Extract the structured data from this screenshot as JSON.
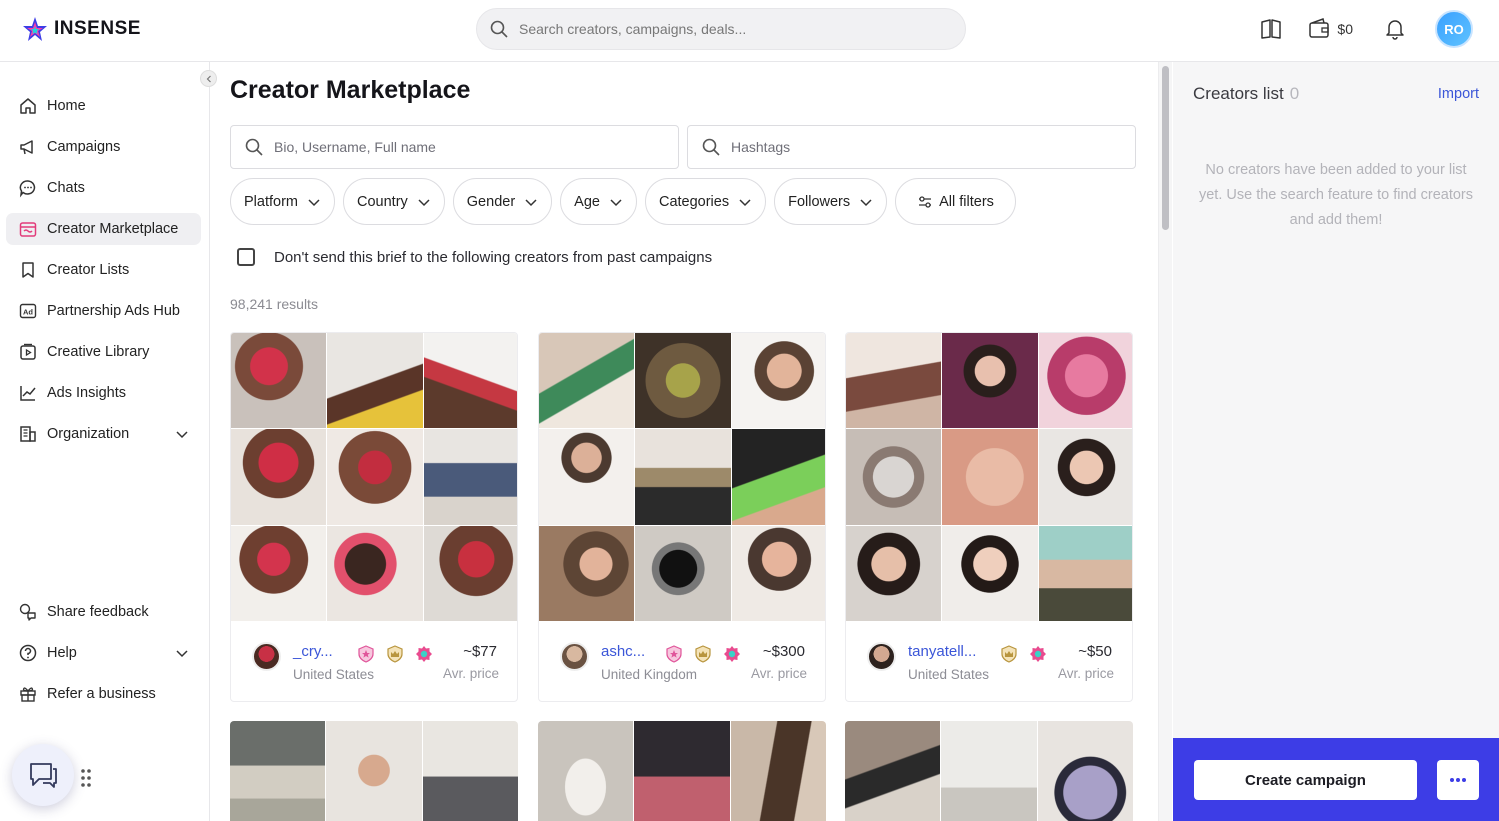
{
  "app": {
    "name": "INSENSE",
    "search_placeholder": "Search creators, campaigns, deals...",
    "wallet_balance": "$0",
    "user_initials": "RO",
    "brand_color": "#3d3de6",
    "link_color": "#3b56d8"
  },
  "sidebar": {
    "items": [
      {
        "label": "Home",
        "icon": "home-icon"
      },
      {
        "label": "Campaigns",
        "icon": "megaphone-icon"
      },
      {
        "label": "Chats",
        "icon": "chat-bubble-icon"
      },
      {
        "label": "Creator Marketplace",
        "icon": "marketplace-icon",
        "active": true
      },
      {
        "label": "Creator Lists",
        "icon": "bookmark-icon"
      },
      {
        "label": "Partnership Ads Hub",
        "icon": "ad-icon"
      },
      {
        "label": "Creative Library",
        "icon": "library-icon"
      },
      {
        "label": "Ads Insights",
        "icon": "line-chart-icon"
      },
      {
        "label": "Organization",
        "icon": "building-icon",
        "expandable": true
      }
    ],
    "bottom_items": [
      {
        "label": "Share feedback",
        "icon": "feedback-icon"
      },
      {
        "label": "Help",
        "icon": "help-icon",
        "expandable": true
      },
      {
        "label": "Refer a business",
        "icon": "gift-icon"
      }
    ]
  },
  "main": {
    "title": "Creator Marketplace",
    "bio_search_placeholder": "Bio, Username, Full name",
    "hashtag_placeholder": "Hashtags",
    "filters": [
      "Platform",
      "Country",
      "Gender",
      "Age",
      "Categories",
      "Followers"
    ],
    "all_filters_label": "All filters",
    "exclude_label": "Don't send this brief to the following creators from past campaigns",
    "results_text": "98,241 results",
    "cards": [
      {
        "username": "_cry...",
        "country": "United States",
        "price": "~$77",
        "price_label": "Avr. price",
        "badges": [
          "shield-star-badge-icon",
          "crown-badge-icon",
          "verified-badge-icon"
        ]
      },
      {
        "username": "ashc...",
        "country": "United Kingdom",
        "price": "~$300",
        "price_label": "Avr. price",
        "badges": [
          "shield-star-badge-icon",
          "crown-badge-icon",
          "verified-badge-icon"
        ]
      },
      {
        "username": "tanyatell...",
        "country": "United States",
        "price": "~$50",
        "price_label": "Avr. price",
        "badges": [
          "crown-badge-icon",
          "verified-badge-icon"
        ]
      }
    ]
  },
  "right_panel": {
    "title": "Creators list",
    "count": "0",
    "import_label": "Import",
    "empty_message": "No creators have been added to your list yet. Use the search feature to find creators and add them!",
    "create_campaign_label": "Create campaign"
  }
}
